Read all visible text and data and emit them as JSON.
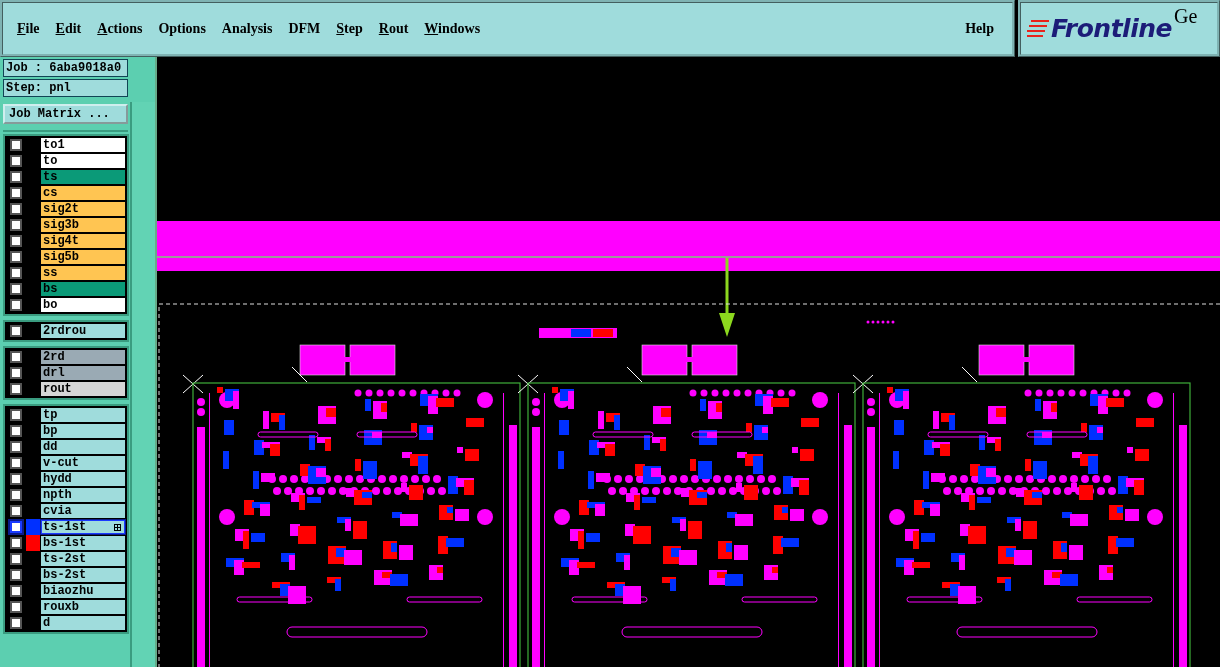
{
  "menu": [
    {
      "label": "File",
      "underlined": true
    },
    {
      "label": "Edit",
      "underlined": true
    },
    {
      "label": "Actions",
      "underlined": true
    },
    {
      "label": "Options",
      "underlined": false
    },
    {
      "label": "Analysis",
      "underlined": false
    },
    {
      "label": "DFM",
      "underlined": false
    },
    {
      "label": "Step",
      "underlined": true
    },
    {
      "label": "Rout",
      "underlined": true
    },
    {
      "label": "Windows",
      "underlined": true
    }
  ],
  "help": "Help",
  "logo": {
    "name": "Frontline",
    "suffix": "Ge"
  },
  "job": "Job : 6aba9018a0",
  "step": "Step: pnl",
  "job_matrix_button": "Job Matrix ...",
  "layer_groups": [
    {
      "layers": [
        {
          "name": "to1",
          "kind": "silk",
          "checked": false,
          "selected": false
        },
        {
          "name": "to",
          "kind": "silk",
          "checked": false,
          "selected": false
        },
        {
          "name": "ts",
          "kind": "mask",
          "checked": false,
          "selected": false
        },
        {
          "name": "cs",
          "kind": "signal",
          "checked": false,
          "selected": false
        },
        {
          "name": "sig2t",
          "kind": "signal",
          "checked": false,
          "selected": false
        },
        {
          "name": "sig3b",
          "kind": "signal",
          "checked": false,
          "selected": false
        },
        {
          "name": "sig4t",
          "kind": "signal",
          "checked": false,
          "selected": false
        },
        {
          "name": "sig5b",
          "kind": "signal",
          "checked": false,
          "selected": false
        },
        {
          "name": "ss",
          "kind": "signal",
          "checked": false,
          "selected": false
        },
        {
          "name": "bs",
          "kind": "mask",
          "checked": false,
          "selected": false
        },
        {
          "name": "bo",
          "kind": "silk",
          "checked": false,
          "selected": false
        }
      ]
    },
    {
      "layers": [
        {
          "name": "2rdrou",
          "kind": "doc",
          "checked": false,
          "selected": false
        }
      ]
    },
    {
      "layers": [
        {
          "name": "2rd",
          "kind": "drill",
          "checked": false,
          "selected": false
        },
        {
          "name": "drl",
          "kind": "drill",
          "checked": false,
          "selected": false
        },
        {
          "name": "rout",
          "kind": "rout",
          "checked": false,
          "selected": false
        }
      ]
    },
    {
      "layers": [
        {
          "name": "tp",
          "kind": "doc",
          "checked": false,
          "selected": false
        },
        {
          "name": "bp",
          "kind": "doc",
          "checked": false,
          "selected": false
        },
        {
          "name": "dd",
          "kind": "doc",
          "checked": false,
          "selected": false
        },
        {
          "name": "v-cut",
          "kind": "doc",
          "checked": false,
          "selected": false
        },
        {
          "name": "hydd",
          "kind": "doc",
          "checked": false,
          "selected": false
        },
        {
          "name": "npth",
          "kind": "doc",
          "checked": false,
          "selected": false
        },
        {
          "name": "cvia",
          "kind": "doc",
          "checked": false,
          "selected": false
        },
        {
          "name": "ts-1st",
          "kind": "doc",
          "checked": false,
          "selected": true,
          "color": "#0030ff"
        },
        {
          "name": "bs-1st",
          "kind": "doc",
          "checked": false,
          "selected": false,
          "color": "#ff0000"
        },
        {
          "name": "ts-2st",
          "kind": "doc",
          "checked": false,
          "selected": false
        },
        {
          "name": "bs-2st",
          "kind": "doc",
          "checked": false,
          "selected": false
        },
        {
          "name": "biaozhu",
          "kind": "doc",
          "checked": false,
          "selected": false
        },
        {
          "name": "rouxb",
          "kind": "doc",
          "checked": false,
          "selected": false
        },
        {
          "name": "d",
          "kind": "doc",
          "checked": false,
          "selected": false
        }
      ]
    }
  ]
}
